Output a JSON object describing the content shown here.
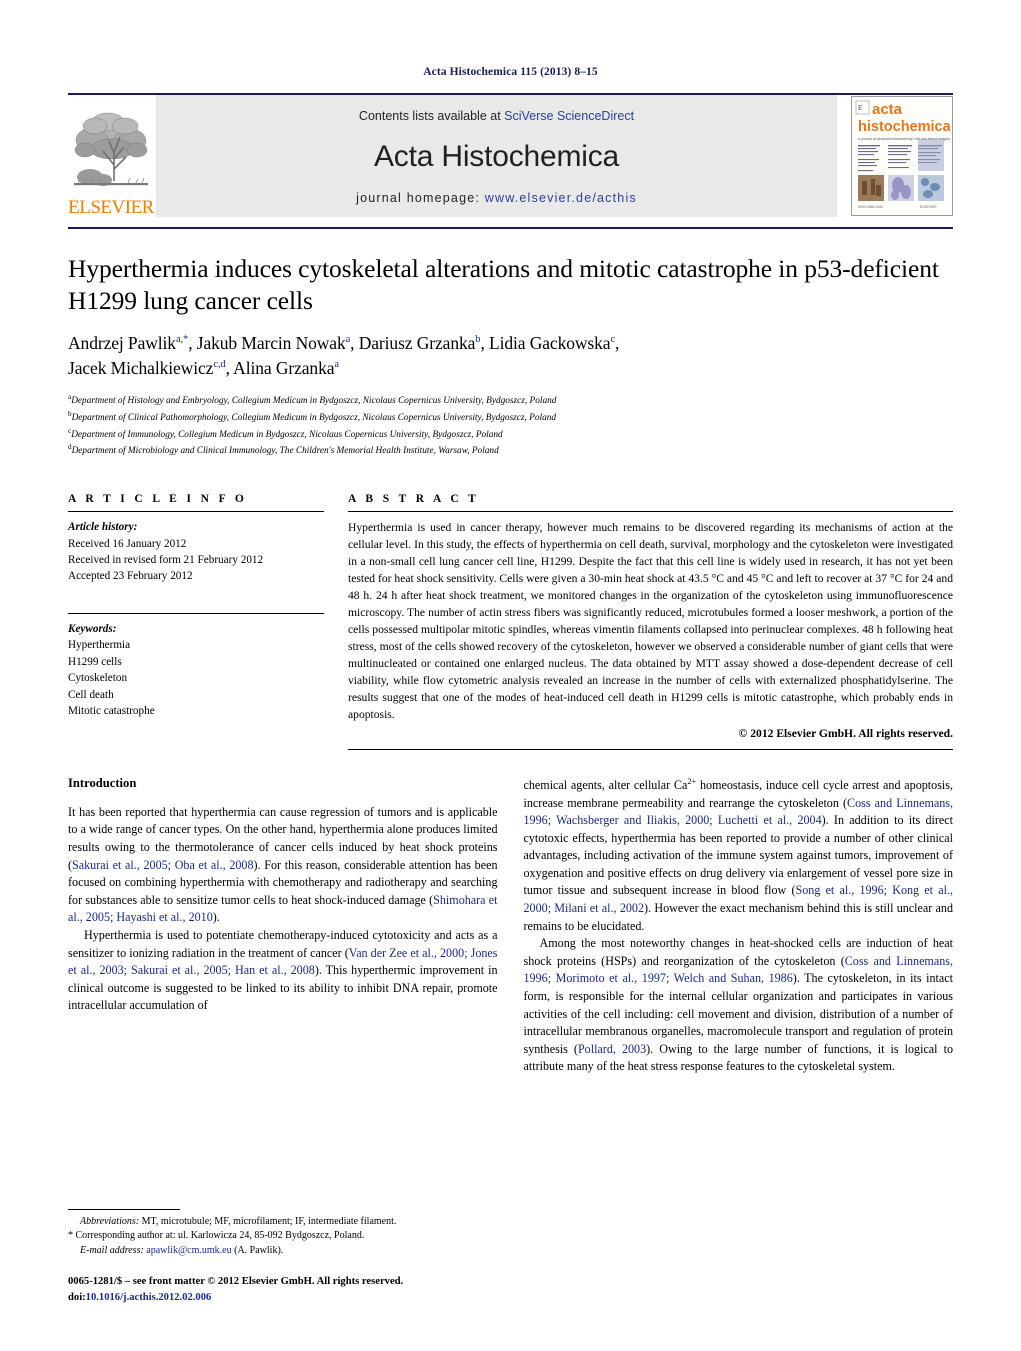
{
  "running_head": "Acta Histochemica 115 (2013) 8–15",
  "masthead": {
    "elsevier_wordmark": "ELSEVIER",
    "contents_prefix": "Contents lists available at ",
    "contents_link": "SciVerse ScienceDirect",
    "journal_title": "Acta Histochemica",
    "homepage_prefix": "journal homepage: ",
    "homepage_url": "www.elsevier.de/acthis",
    "cover_title_line1": "acta",
    "cover_title_line2": "histochemica",
    "cover_subtitle": "a journal of structural biochemistry, cell and tissue imaging"
  },
  "article": {
    "title": "Hyperthermia induces cytoskeletal alterations and mitotic catastrophe in p53-deficient H1299 lung cancer cells",
    "authors_line1": "Andrzej Pawlik",
    "authors_line1_sup": "a,*",
    "authors_line1_rest": ", Jakub Marcin Nowak",
    "authors_line1_sup2": "a",
    "authors_line1_rest2": ", Dariusz Grzanka",
    "authors_line1_sup3": "b",
    "authors_line1_rest3": ", Lidia Gackowska",
    "authors_line1_sup4": "c",
    "authors_line1_end": ",",
    "authors_line2": "Jacek Michalkiewicz",
    "authors_line2_sup": "c,d",
    "authors_line2_rest": ", Alina Grzanka",
    "authors_line2_sup2": "a",
    "affiliations": [
      {
        "marker": "a",
        "text": "Department of Histology and Embryology, Collegium Medicum in Bydgoszcz, Nicolaus Copernicus University, Bydgoszcz, Poland"
      },
      {
        "marker": "b",
        "text": "Department of Clinical Pathomorphology, Collegium Medicum in Bydgoszcz, Nicolaus Copernicus University, Bydgoszcz, Poland"
      },
      {
        "marker": "c",
        "text": "Department of Immunology, Collegium Medicum in Bydgoszcz, Nicolaus Copernicus University, Bydgoszcz, Poland"
      },
      {
        "marker": "d",
        "text": "Department of Microbiology and Clinical Immunology, The Children's Memorial Health Institute, Warsaw, Poland"
      }
    ]
  },
  "article_info": {
    "heading": "A R T I C L E   I N F O",
    "history_label": "Article history:",
    "history": [
      "Received 16 January 2012",
      "Received in revised form 21 February 2012",
      "Accepted 23 February 2012"
    ],
    "keywords_label": "Keywords:",
    "keywords": [
      "Hyperthermia",
      "H1299 cells",
      "Cytoskeleton",
      "Cell death",
      "Mitotic catastrophe"
    ]
  },
  "abstract": {
    "heading": "A B S T R A C T",
    "text": "Hyperthermia is used in cancer therapy, however much remains to be discovered regarding its mechanisms of action at the cellular level. In this study, the effects of hyperthermia on cell death, survival, morphology and the cytoskeleton were investigated in a non-small cell lung cancer cell line, H1299. Despite the fact that this cell line is widely used in research, it has not yet been tested for heat shock sensitivity. Cells were given a 30-min heat shock at 43.5 °C and 45 °C and left to recover at 37 °C for 24 and 48 h. 24 h after heat shock treatment, we monitored changes in the organization of the cytoskeleton using immunofluorescence microscopy. The number of actin stress fibers was significantly reduced, microtubules formed a looser meshwork, a portion of the cells possessed multipolar mitotic spindles, whereas vimentin filaments collapsed into perinuclear complexes. 48 h following heat stress, most of the cells showed recovery of the cytoskeleton, however we observed a considerable number of giant cells that were multinucleated or contained one enlarged nucleus. The data obtained by MTT assay showed a dose-dependent decrease of cell viability, while flow cytometric analysis revealed an increase in the number of cells with externalized phosphatidylserine. The results suggest that one of the modes of heat-induced cell death in H1299 cells is mitotic catastrophe, which probably ends in apoptosis.",
    "copyright": "© 2012 Elsevier GmbH. All rights reserved."
  },
  "introduction": {
    "heading": "Introduction",
    "left_para1_a": "It has been reported that hyperthermia can cause regression of tumors and is applicable to a wide range of cancer types. On the other hand, hyperthermia alone produces limited results owing to the thermotolerance of cancer cells induced by heat shock proteins (",
    "left_para1_cite1": "Sakurai et al., 2005; Oba et al., 2008",
    "left_para1_b": "). For this reason, considerable attention has been focused on combining hyperthermia with chemotherapy and radiotherapy and searching for substances able to sensitize tumor cells to heat shock-induced damage (",
    "left_para1_cite2": "Shimohara et al., 2005; Hayashi et al., 2010",
    "left_para1_c": ").",
    "left_para2_a": "Hyperthermia is used to potentiate chemotherapy-induced cytotoxicity and acts as a sensitizer to ionizing radiation in the treatment of cancer (",
    "left_para2_cite1": "Van der Zee et al., 2000; Jones et al., 2003; Sakurai et al., 2005; Han et al., 2008",
    "left_para2_b": "). This hyperthermic improvement in clinical outcome is suggested to be linked to its ability to inhibit DNA repair, promote intracellular accumulation of",
    "right_para1_a": "chemical agents, alter cellular Ca",
    "right_para1_sup": "2+",
    "right_para1_b": " homeostasis, induce cell cycle arrest and apoptosis, increase membrane permeability and rearrange the cytoskeleton (",
    "right_para1_cite1": "Coss and Linnemans, 1996; Wachsberger and Iliakis, 2000; Luchetti et al., 2004",
    "right_para1_c": "). In addition to its direct cytotoxic effects, hyperthermia has been reported to provide a number of other clinical advantages, including activation of the immune system against tumors, improvement of oxygenation and positive effects on drug delivery via enlargement of vessel pore size in tumor tissue and subsequent increase in blood flow (",
    "right_para1_cite2": "Song et al., 1996; Kong et al., 2000; Milani et al., 2002",
    "right_para1_d": "). However the exact mechanism behind this is still unclear and remains to be elucidated.",
    "right_para2_a": "Among the most noteworthy changes in heat-shocked cells are induction of heat shock proteins (HSPs) and reorganization of the cytoskeleton (",
    "right_para2_cite1": "Coss and Linnemans, 1996; Morimoto et al., 1997; Welch and Suhan, 1986",
    "right_para2_b": "). The cytoskeleton, in its intact form, is responsible for the internal cellular organization and participates in various activities of the cell including: cell movement and division, distribution of a number of intracellular membranous organelles, macromolecule transport and regulation of protein synthesis (",
    "right_para2_cite2": "Pollard, 2003",
    "right_para2_c": "). Owing to the large number of functions, it is logical to attribute many of the heat stress response features to the cytoskeletal system."
  },
  "footnotes": {
    "abbreviations_label": "Abbreviations:",
    "abbreviations_text": " MT, microtubule; MF, microfilament; IF, intermediate filament.",
    "corresponding_marker": "*",
    "corresponding_text": " Corresponding author at: ul. Karlowicza 24, 85-092 Bydgoszcz, Poland.",
    "email_label": "E-mail address:",
    "email": "apawlik@cm.umk.eu",
    "email_suffix": " (A. Pawlik).",
    "imprint": "0065-1281/$ – see front matter © 2012 Elsevier GmbH. All rights reserved.",
    "doi_label": "doi:",
    "doi_value": "10.1016/j.acthis.2012.02.006"
  },
  "colors": {
    "journal_blue": "#1a1a5e",
    "link_blue": "#2b3f9c",
    "citation_blue": "#1a2a8a",
    "elsevier_orange": "#ef7d00",
    "banner_gray": "#e9e9e9"
  }
}
